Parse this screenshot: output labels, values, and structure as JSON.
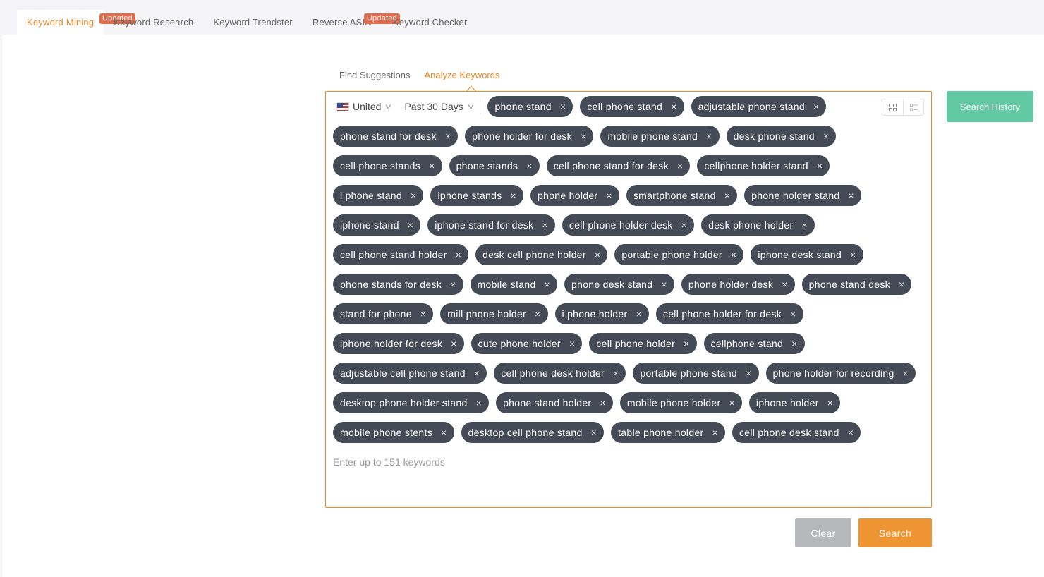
{
  "top_tabs": [
    {
      "label": "Keyword Mining",
      "badge": "Updated",
      "active": true
    },
    {
      "label": "Keyword Research",
      "badge": "",
      "active": false
    },
    {
      "label": "Keyword Trendster",
      "badge": "",
      "active": false
    },
    {
      "label": "Reverse ASIN",
      "badge": "Updated",
      "active": false
    },
    {
      "label": "Keyword Checker",
      "badge": "",
      "active": false
    }
  ],
  "sub_tabs": [
    {
      "label": "Find Suggestions",
      "active": false
    },
    {
      "label": "Analyze Keywords",
      "active": true
    }
  ],
  "filters": {
    "country": "United",
    "period": "Past 30 Days"
  },
  "tags": [
    "phone stand",
    "cell phone stand",
    "adjustable phone stand",
    "phone stand for desk",
    "phone holder for desk",
    "mobile phone stand",
    "desk phone stand",
    "cell phone stands",
    "phone stands",
    "cell phone stand for desk",
    "cellphone holder stand",
    "i phone stand",
    "iphone stands",
    "phone holder",
    "smartphone stand",
    "phone holder stand",
    "iphone stand",
    "iphone stand for desk",
    "cell phone holder desk",
    "desk phone holder",
    "cell phone stand holder",
    "desk cell phone holder",
    "portable phone holder",
    "iphone desk stand",
    "phone stands for desk",
    "mobile stand",
    "phone desk stand",
    "phone holder desk",
    "phone stand desk",
    "stand for phone",
    "mill phone holder",
    "i phone holder",
    "cell phone holder for desk",
    "iphone holder for desk",
    "cute phone holder",
    "cell phone holder",
    "cellphone stand",
    "adjustable cell phone stand",
    "cell phone desk holder",
    "portable phone stand",
    "phone holder for recording",
    "desktop phone holder stand",
    "phone stand holder",
    "mobile phone holder",
    "iphone holder",
    "mobile phone stents",
    "desktop cell phone stand",
    "table phone holder",
    "cell phone desk stand"
  ],
  "tag_close_glyph": "×",
  "keyword_input": {
    "value": "",
    "placeholder": "Enter up to 151 keywords"
  },
  "buttons": {
    "search_history": "Search History",
    "clear": "Clear",
    "search": "Search"
  },
  "colors": {
    "accent": "#e8892a",
    "badge": "#e56a4b",
    "tag_bg": "#454a57",
    "history": "#62c8a4",
    "clear": "#b7b8bb",
    "search": "#ef9433"
  }
}
